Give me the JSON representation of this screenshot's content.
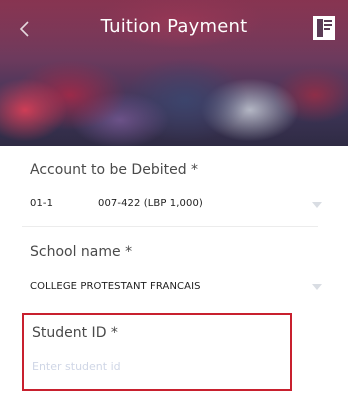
{
  "header": {
    "title": "Tuition Payment",
    "back_icon": "chevron-left-icon",
    "action_icon": "receipt-icon"
  },
  "form": {
    "account": {
      "label": "Account to be Debited *",
      "value_prefix": "01-1",
      "value_main": "007-422 (LBP 1,000)"
    },
    "school": {
      "label": "School name *",
      "value": "COLLEGE PROTESTANT FRANCAIS"
    },
    "student": {
      "label": "Student ID *",
      "placeholder": "Enter student id",
      "value": ""
    }
  },
  "colors": {
    "highlight_border": "#c8202e",
    "placeholder": "#cfd6e6"
  }
}
